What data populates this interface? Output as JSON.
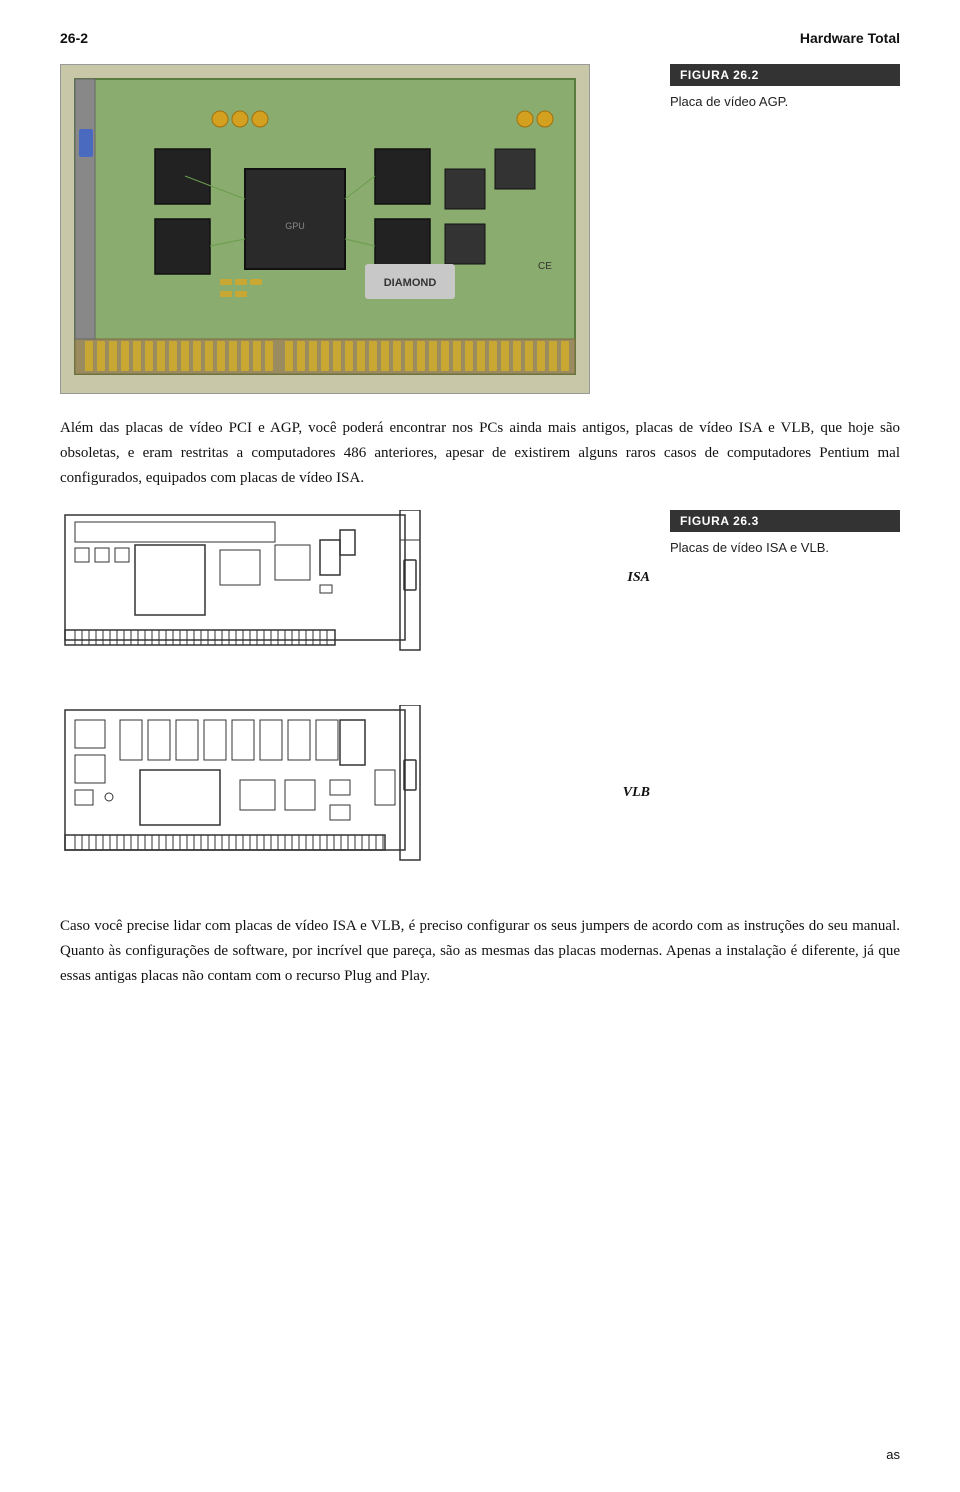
{
  "header": {
    "page_number": "26-2",
    "book_title": "Hardware Total"
  },
  "figure_top": {
    "label": "Figura 26.2",
    "description": "Placa de vídeo AGP."
  },
  "paragraph1": "Além das placas de vídeo PCI e AGP, você poderá encontrar nos PCs ainda mais antigos, placas de vídeo ISA e VLB, que hoje são obsoletas, e eram restritas a computadores 486 anteriores, apesar de existirem alguns raros casos de computadores Pentium mal configurados, equipados com placas de vídeo ISA.",
  "figure_middle": {
    "label": "Figura 26.3",
    "description": "Placas de vídeo ISA e VLB.",
    "isa_label": "ISA",
    "vlb_label": "VLB"
  },
  "paragraph2": "Caso você precise lidar com placas de vídeo ISA e VLB, é preciso configurar os seus jumpers de acordo com as instruções do seu manual. Quanto às configurações de software, por incrível que pareça, são as mesmas das placas modernas. Apenas a instalação é diferente, já que essas antigas placas não contam com o recurso Plug and Play.",
  "footer_text": "as"
}
